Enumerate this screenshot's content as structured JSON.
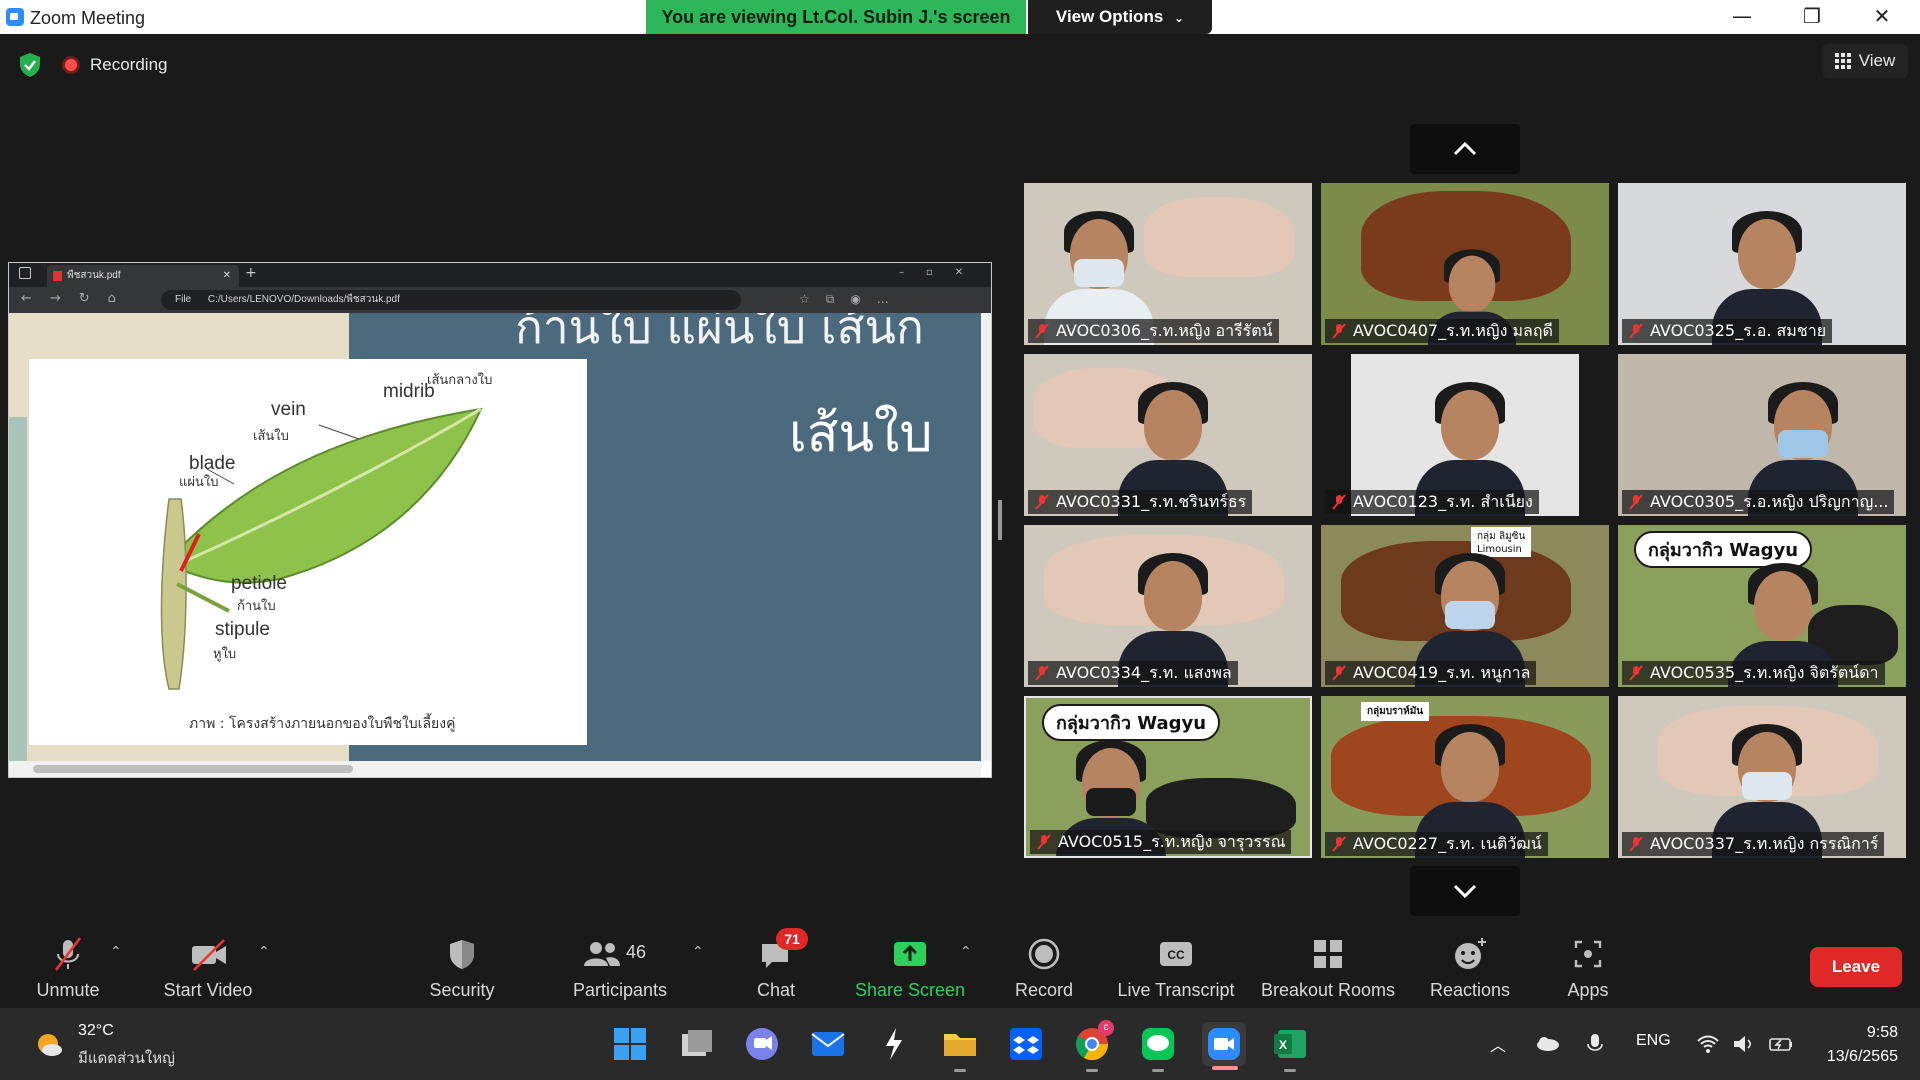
{
  "window": {
    "title": "Zoom Meeting",
    "banner": "You are viewing Lt.Col. Subin J.'s screen",
    "view_options": "View Options"
  },
  "meeting": {
    "recording_label": "Recording",
    "view_label": "View"
  },
  "shared_screen": {
    "browser_tab": "พืชสวนk.pdf",
    "address_prefix": "File",
    "address": "C:/Users/LENOVO/Downloads/พืชสวนk.pdf",
    "slide_top_text": "ก้านใบ แผ่นใบ เส้นก",
    "slide_heading": "เส้นใบ",
    "labels": {
      "midrib_th": "เส้นกลางใบ",
      "midrib": "midrib",
      "vein": "vein",
      "vein_th": "เส้นใบ",
      "blade": "blade",
      "blade_th": "แผ่นใบ",
      "petiole": "petiole",
      "petiole_th": "ก้านใบ",
      "stipule": "stipule",
      "stipule_th": "หูใบ"
    },
    "caption": "ภาพ : โครงสร้างภายนอกของใบพืชใบเลี้ยงคู่"
  },
  "participants": [
    {
      "name": "AVOC0306_ร.ท.หญิง อารีรัตน์",
      "muted": true,
      "bg": "#cfc8bd"
    },
    {
      "name": "AVOC0407_ร.ท.หญิง มลฤดี",
      "muted": true,
      "bg": "#7c8a4a"
    },
    {
      "name": "AVOC0325_ร.อ. สมชาย",
      "muted": true,
      "bg": "#d7d9dc"
    },
    {
      "name": "AVOC0331_ร.ท.ชรินทร์ธร",
      "muted": true,
      "bg": "#cfc8bd"
    },
    {
      "name": "AVOC0123_ร.ท. สำเนียง",
      "muted": true,
      "bg": "#e5e5e5"
    },
    {
      "name": "AVOC0305_ร.อ.หญิง ปริญกาญ...",
      "muted": true,
      "bg": "#bfb7aa"
    },
    {
      "name": "AVOC0334_ร.ท. แสงพล",
      "muted": true,
      "bg": "#cfc8bd"
    },
    {
      "name": "AVOC0419_ร.ท. หนูกาล",
      "muted": true,
      "bg": "#8c8a5c"
    },
    {
      "name": "AVOC0535_ร.ท.หญิง จิตรัตน์ดา",
      "muted": true,
      "bg": "#8ba05c"
    },
    {
      "name": "AVOC0515_ร.ท.หญิง จารุวรรณ",
      "muted": true,
      "bg": "#8ba05c"
    },
    {
      "name": "AVOC0227_ร.ท. เนติวัฒน์",
      "muted": true,
      "bg": "#8a9a5a"
    },
    {
      "name": "AVOC0337_ร.ท.หญิง กรรณิการ์",
      "muted": true,
      "bg": "#cfc8bd"
    }
  ],
  "tile_signs": {
    "wagyu": "กลุ่มวากิว Wagyu",
    "brahman": "กลุ่มบราห์มัน",
    "group_sign_line1": "กลุ่ม ลิมูซิน",
    "group_sign_line2": "Limousin"
  },
  "toolbar": {
    "unmute": "Unmute",
    "start_video": "Start Video",
    "security": "Security",
    "participants": "Participants",
    "participants_count": "46",
    "chat": "Chat",
    "chat_badge": "71",
    "share_screen": "Share Screen",
    "record": "Record",
    "live_transcript": "Live Transcript",
    "breakout_rooms": "Breakout Rooms",
    "reactions": "Reactions",
    "apps": "Apps",
    "leave": "Leave"
  },
  "taskbar": {
    "temperature": "32°C",
    "weather_desc": "มีแดดส่วนใหญ่",
    "language": "ENG",
    "time": "9:58",
    "date": "13/6/2565",
    "chrome_badge": "c"
  },
  "colors": {
    "banner_green": "#2eb65a",
    "share_green": "#2fcf5c",
    "leave_red": "#e02828",
    "zoom_blue": "#2d8cff"
  }
}
